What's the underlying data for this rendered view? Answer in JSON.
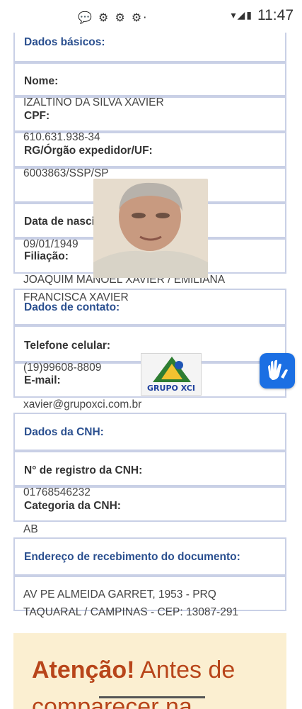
{
  "status_bar": {
    "left_icons": "💬 ⚙ ⚙ ⚙·",
    "right_icons": "▾◢▮",
    "time": "11:47"
  },
  "sections": {
    "basic": {
      "title": "Dados básicos:",
      "name_label": "Nome:",
      "name_value": "IZALTINO DA SILVA XAVIER",
      "cpf_label": "CPF:",
      "cpf_value": "610.631.938-34",
      "rg_label": "RG/Órgão expedidor/UF:",
      "rg_value": "6003863/SSP/SP",
      "birth_label": "Data de nascimento:",
      "birth_value": "09/01/1949",
      "parents_label": "Filiação:",
      "parents_value": "JOAQUIM MANOEL XAVIER / EMILIANA FRANCISCA XAVIER"
    },
    "contact": {
      "title": "Dados de contato:",
      "phone_label": "Telefone celular:",
      "phone_value": "(19)99608-8809",
      "email_label": "E-mail:",
      "email_value": "xavier@grupoxci.com.br"
    },
    "cnh": {
      "title": "Dados da CNH:",
      "register_label": "N° de registro da CNH:",
      "register_value": "01768546232",
      "category_label": "Categoria da CNH:",
      "category_value": "AB"
    },
    "address": {
      "title": "Endereço de recebimento do documento:",
      "value": "AV PE ALMEIDA GARRET, 1953 - PRQ TAQUARAL / CAMPINAS - CEP: 13087-291"
    }
  },
  "logo": {
    "text": "GRUPO XCI"
  },
  "warning": {
    "bold": "Atenção!",
    "text": " Antes de comparecer na"
  },
  "colors": {
    "section_title": "#2a4f8f",
    "box_border": "#c9d0e6",
    "warning_bg": "#fbefd1",
    "warning_text": "#b8451a",
    "a11y_button": "#1b6fe3"
  }
}
